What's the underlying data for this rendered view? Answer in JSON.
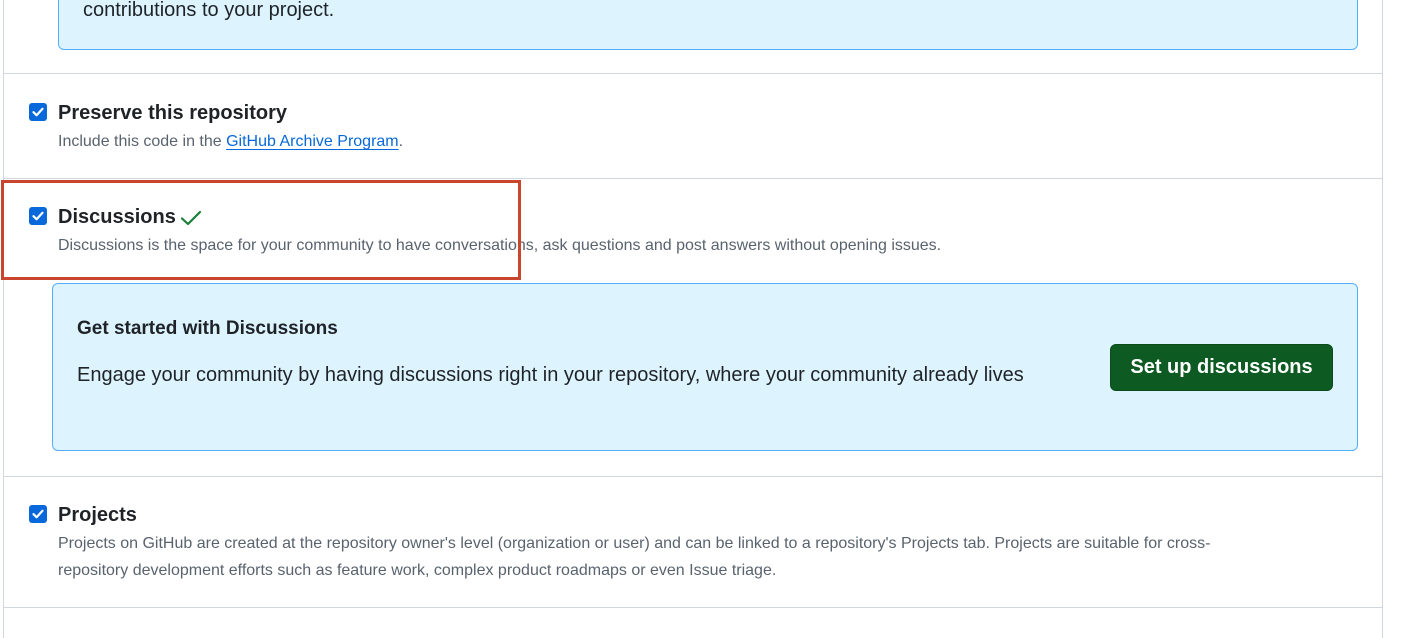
{
  "top_callout": {
    "text": "contributions to your project."
  },
  "options": {
    "preserve": {
      "title": "Preserve this repository",
      "desc_prefix": "Include this code in the ",
      "desc_link": "GitHub Archive Program",
      "desc_suffix": ".",
      "checked": true
    },
    "discussions": {
      "title": "Discussions",
      "desc": "Discussions is the space for your community to have conversations, ask questions and post answers without opening issues.",
      "checked": true,
      "status_icon": "check-icon"
    },
    "projects": {
      "title": "Projects",
      "desc_line1": "Projects on GitHub are created at the repository owner's level (organization or user) and can be linked to a repository's Projects tab. Projects are suitable for cross-",
      "desc_line2": "repository development efforts such as feature work, complex product roadmaps or even Issue triage.",
      "checked": true
    }
  },
  "discussions_callout": {
    "title": "Get started with Discussions",
    "body": "Engage your community by having discussions right in your repository, where your community already lives",
    "button_label": "Set up discussions"
  },
  "colors": {
    "accent": "#0969da",
    "callout_bg": "#ddf4ff",
    "button_green": "#0d5b22",
    "highlight": "#c9452e",
    "success_check": "#1a7f37"
  }
}
